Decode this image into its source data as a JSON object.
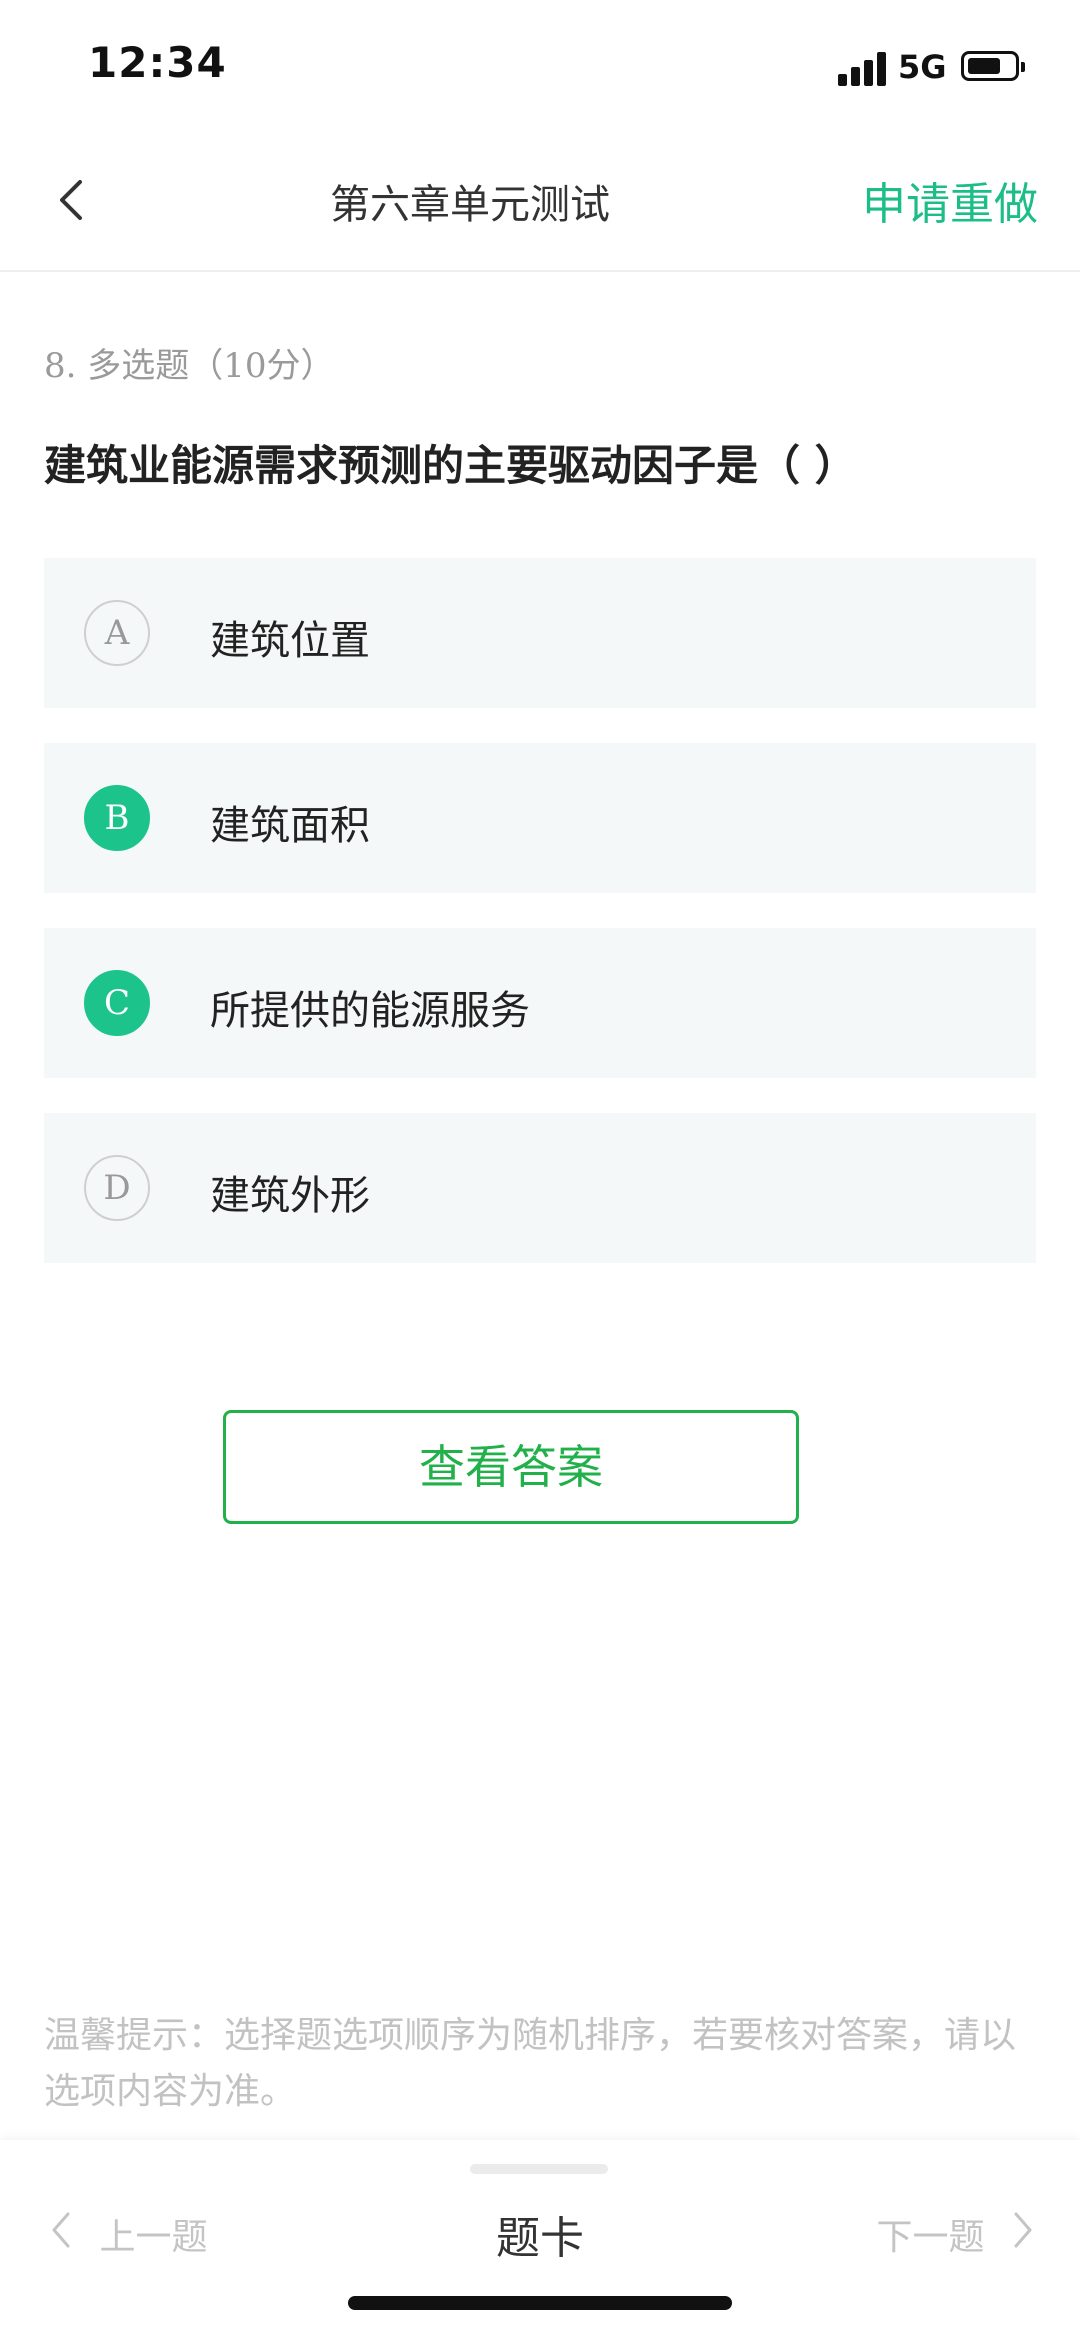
{
  "status_bar": {
    "time": "12:34",
    "network": "5G",
    "signal_bars": 4,
    "battery_level": 0.6
  },
  "header": {
    "title": "第六章单元测试",
    "redo_label": "申请重做",
    "back_icon": "chevron-left-icon",
    "accent_color": "#1cbd87"
  },
  "question": {
    "meta": "8. 多选题（10分）",
    "text": "建筑业能源需求预测的主要驱动因子是（ ）",
    "options": [
      {
        "letter": "A",
        "text": "建筑位置",
        "selected": false
      },
      {
        "letter": "B",
        "text": "建筑面积",
        "selected": true
      },
      {
        "letter": "C",
        "text": "所提供的能源服务",
        "selected": true
      },
      {
        "letter": "D",
        "text": "建筑外形",
        "selected": false
      }
    ],
    "selected_color": "#1cc48c"
  },
  "actions": {
    "view_answer_label": "查看答案",
    "button_color": "#22b04a"
  },
  "tip": "温馨提示：选择题选项顺序为随机排序，若要核对答案，请以选项内容为准。",
  "bottom_nav": {
    "prev_label": "上一题",
    "card_label": "题卡",
    "next_label": "下一题"
  }
}
